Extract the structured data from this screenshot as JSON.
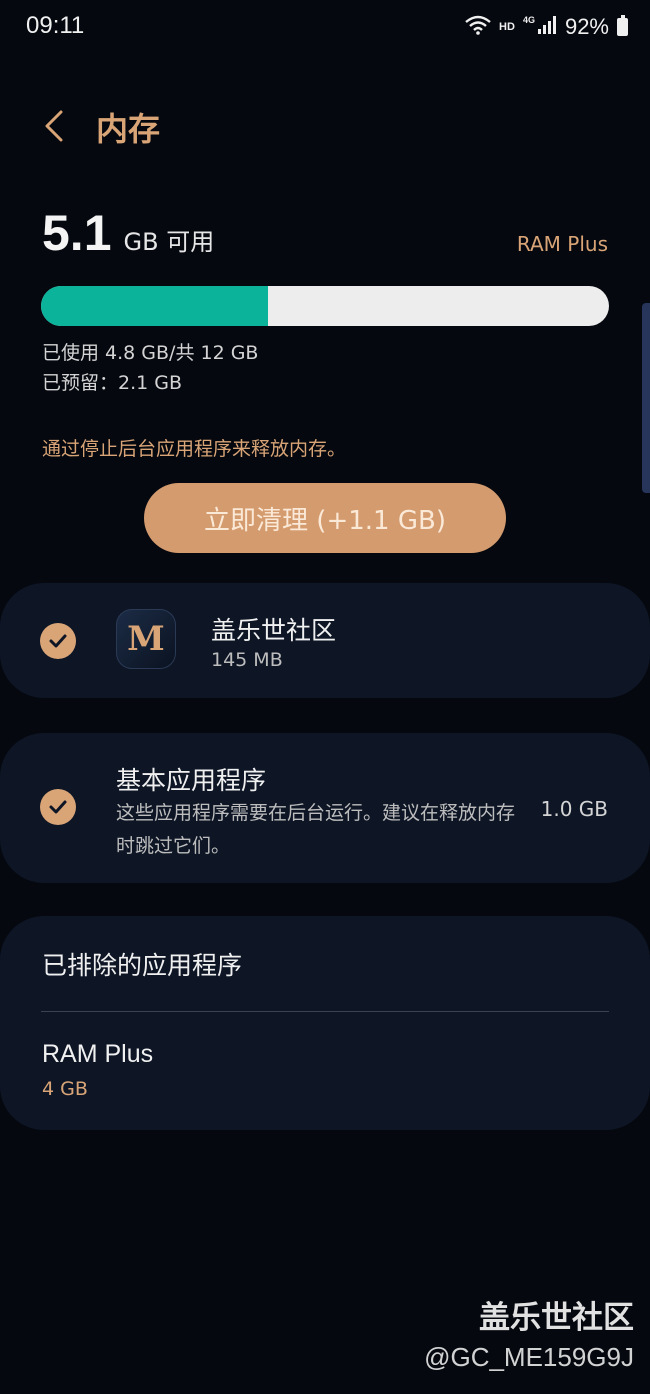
{
  "status_bar": {
    "time": "09:11",
    "hd_label": "HD",
    "network_label": "4G",
    "battery_percent": "92%"
  },
  "header": {
    "title": "内存"
  },
  "summary": {
    "available_value": "5.1",
    "available_unit": "GB 可用",
    "ram_plus_link": "RAM Plus",
    "used_fraction": 0.4,
    "used_text": "已使用 4.8 GB/共 12 GB",
    "reserved_text": "已预留：2.1 GB",
    "hint": "通过停止后台应用程序来释放内存。",
    "clean_button": "立即清理 (+1.1 GB)"
  },
  "apps": [
    {
      "name": "盖乐世社区",
      "size": "145 MB",
      "checked": true,
      "icon": "galaxy-members-icon"
    }
  ],
  "basic_apps": {
    "title": "基本应用程序",
    "description": "这些应用程序需要在后台运行。建议在释放内存时跳过它们。",
    "size": "1.0 GB",
    "checked": true
  },
  "excluded": {
    "title": "已排除的应用程序",
    "ram_plus_name": "RAM Plus",
    "ram_plus_size": "4 GB"
  },
  "watermark": {
    "title": "盖乐世社区",
    "user": "@GC_ME159G9J"
  },
  "colors": {
    "accent": "#d9a577",
    "progress_fill": "#0ab39a",
    "card_bg": "#0e1626",
    "page_bg": "#05080f"
  }
}
